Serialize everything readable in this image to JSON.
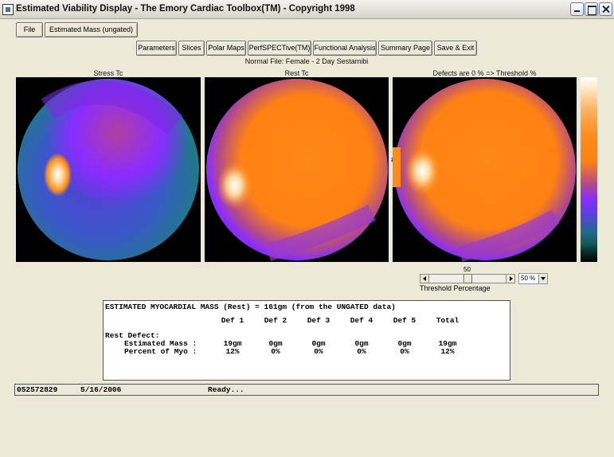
{
  "window": {
    "title": "Estimated Viability Display - The Emory Cardiac Toolbox(TM) - Copyright 1998"
  },
  "menu": {
    "file": "File",
    "mode": "Estimated Mass (ungated)"
  },
  "toolbar": {
    "parameters": "Parameters",
    "slices": "Slices",
    "polar_maps": "Polar Maps",
    "perfspective": "PerfSPECTive(TM)",
    "functional": "Functional Analysis",
    "summary": "Summary Page",
    "save_exit": "Save & Exit"
  },
  "normal_file": "Normal File:  Female - 2 Day Sestamibi",
  "maps": {
    "stress": "Stress Tc",
    "rest": "Rest Tc",
    "defects": "Defects are 0 % => Threshold %",
    "marker": "#1"
  },
  "threshold": {
    "value": 50,
    "value_label": "50",
    "label": "Threshold Percentage",
    "select": "50 %"
  },
  "colors": {
    "window_bg": "#ece9d8",
    "orange": "#ff8c1a",
    "purple": "#8a2cff",
    "teal": "#1e7a86"
  },
  "report": {
    "title": "ESTIMATED MYOCARDIAL MASS (Rest) =  161gm (from the UNGATED data)",
    "headers": [
      "Def 1",
      "Def 2",
      "Def 3",
      "Def 4",
      "Def 5",
      "Total"
    ],
    "section": "Rest Defect:",
    "rows": [
      {
        "label": "Estimated Mass   :",
        "values": [
          "19gm",
          "0gm",
          "0gm",
          "0gm",
          "0gm",
          "19gm"
        ]
      },
      {
        "label": "Percent of Myo   :",
        "values": [
          "12%",
          "0%",
          "0%",
          "0%",
          "0%",
          "12%"
        ]
      }
    ]
  },
  "status": {
    "id": "052572829",
    "date": "5/16/2006",
    "message": "Ready..."
  }
}
